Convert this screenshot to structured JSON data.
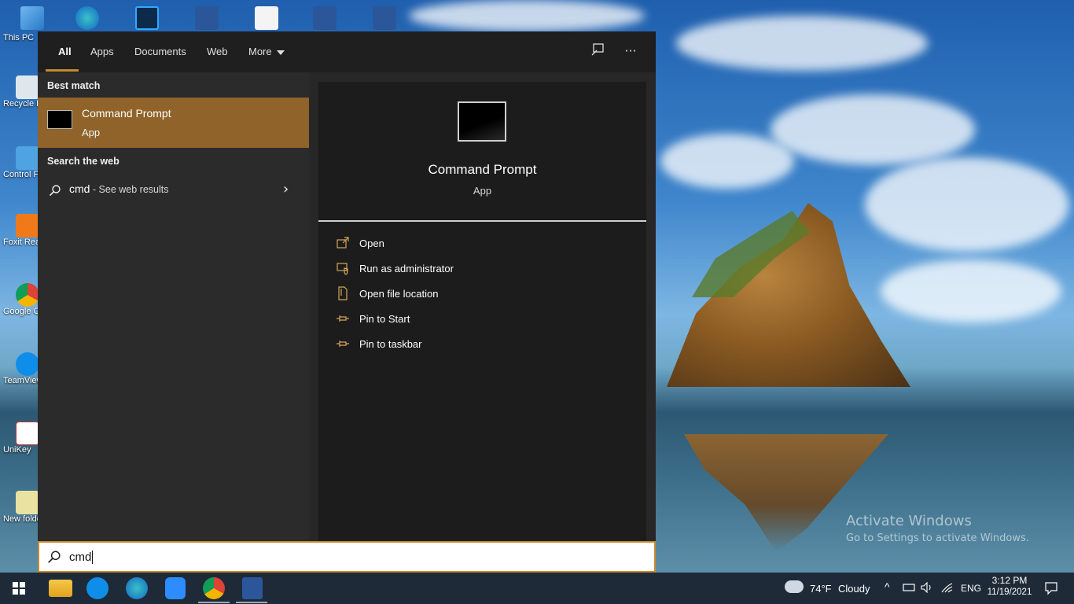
{
  "desktop": {
    "icons": [
      {
        "label": "This PC"
      },
      {
        "label": "Recycle Bin"
      },
      {
        "label": "Control Panel"
      },
      {
        "label": "Foxit Reader"
      },
      {
        "label": "Google Chrome"
      },
      {
        "label": "TeamViewer"
      },
      {
        "label": "UniKey"
      },
      {
        "label": "New folder"
      }
    ],
    "watermark": {
      "title": "Activate Windows",
      "subtitle": "Go to Settings to activate Windows."
    }
  },
  "search_panel": {
    "tabs": [
      {
        "label": "All",
        "active": true
      },
      {
        "label": "Apps"
      },
      {
        "label": "Documents"
      },
      {
        "label": "Web"
      },
      {
        "label": "More"
      }
    ],
    "tools": {
      "feedback_icon": "feedback-icon",
      "more_options": "···"
    },
    "best_match": {
      "heading": "Best match",
      "title": "Command Prompt",
      "subtitle": "App"
    },
    "web": {
      "heading": "Search the web",
      "query": "cmd",
      "hint": " - See web results"
    },
    "preview": {
      "title": "Command Prompt",
      "subtitle": "App",
      "actions": [
        {
          "label": "Open",
          "icon": "open-icon"
        },
        {
          "label": "Run as administrator",
          "icon": "admin-shield-icon"
        },
        {
          "label": "Open file location",
          "icon": "file-location-icon"
        },
        {
          "label": "Pin to Start",
          "icon": "pin-icon"
        },
        {
          "label": "Pin to taskbar",
          "icon": "pin-icon"
        }
      ]
    },
    "searchbox": {
      "value": "cmd"
    }
  },
  "taskbar": {
    "weather": {
      "temp": "74°F",
      "condition": "Cloudy"
    },
    "language": "ENG",
    "clock": {
      "time": "3:12 PM",
      "date": "11/19/2021"
    }
  },
  "colors": {
    "accent": "#c58a2e",
    "selected_item": "#8f6329",
    "panel_bg": "#272727",
    "taskbar_bg": "#1e2a38"
  }
}
